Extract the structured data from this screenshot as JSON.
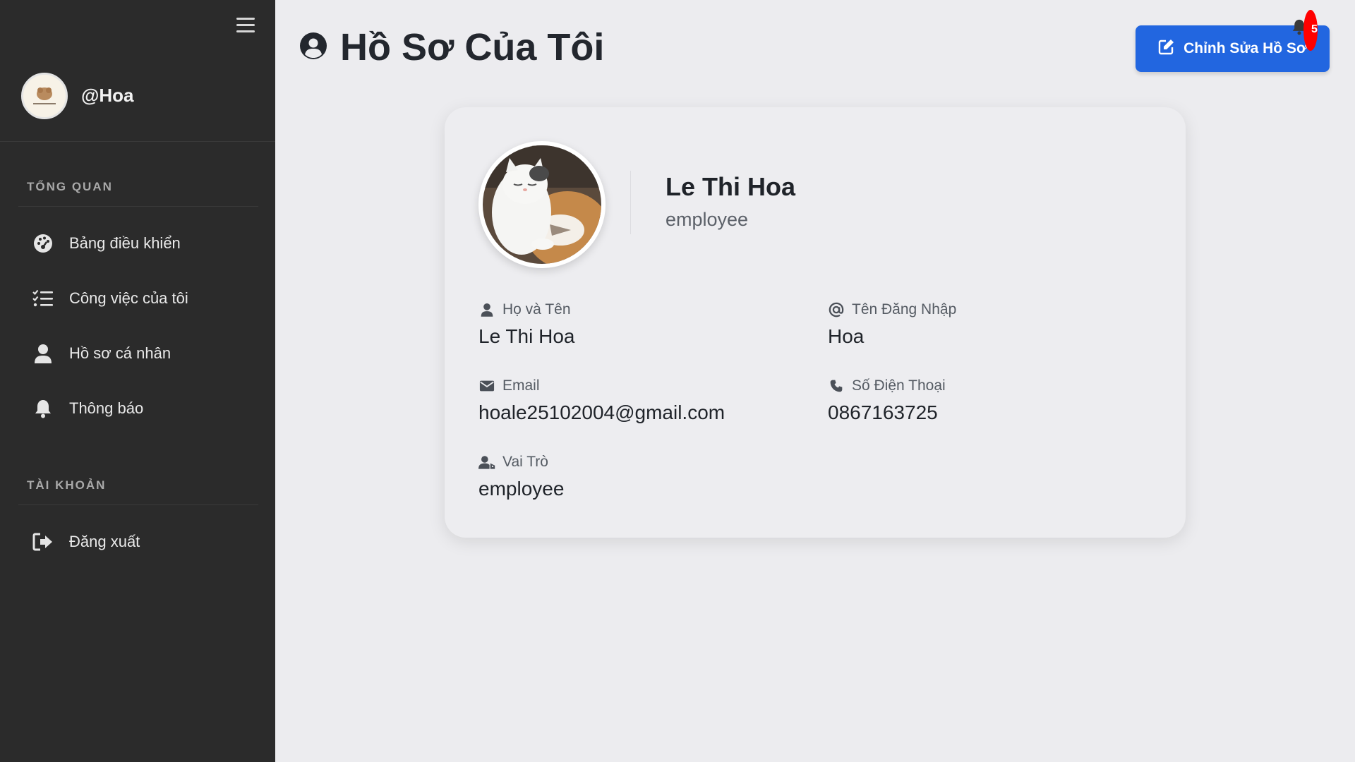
{
  "sidebar": {
    "username": "@Hoa",
    "sections": [
      {
        "label": "TỔNG QUAN",
        "items": [
          {
            "label": "Bảng điều khiển",
            "icon": "dashboard-icon"
          },
          {
            "label": "Công việc của tôi",
            "icon": "task-list-icon"
          },
          {
            "label": "Hồ sơ cá nhân",
            "icon": "user-icon"
          },
          {
            "label": "Thông báo",
            "icon": "bell-icon"
          }
        ]
      },
      {
        "label": "TÀI KHOẢN",
        "items": [
          {
            "label": "Đăng xuất",
            "icon": "logout-icon"
          }
        ]
      }
    ]
  },
  "header": {
    "title": "Hồ Sơ Của Tôi",
    "edit_button": "Chỉnh Sửa Hồ Sơ",
    "notification_count": "5"
  },
  "profile": {
    "name": "Le Thi Hoa",
    "role": "employee",
    "fields": {
      "full_name": {
        "label": "Họ và Tên",
        "value": "Le Thi Hoa"
      },
      "username": {
        "label": "Tên Đăng Nhập",
        "value": "Hoa"
      },
      "email": {
        "label": "Email",
        "value": "hoale25102004@gmail.com"
      },
      "phone": {
        "label": "Số Điện Thoại",
        "value": "0867163725"
      },
      "role": {
        "label": "Vai Trò",
        "value": "employee"
      }
    }
  },
  "colors": {
    "sidebar_bg": "#2b2b2b",
    "page_bg": "#ececef",
    "accent": "#2266e0",
    "badge": "#ff0000"
  }
}
